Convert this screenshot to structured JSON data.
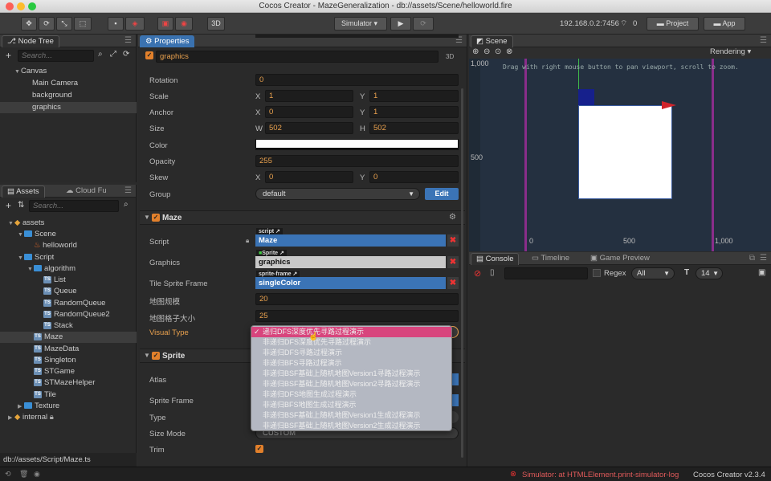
{
  "window": {
    "title": "Cocos Creator - MazeGeneralization - db://assets/Scene/helloworld.fire"
  },
  "toolbar": {
    "btn_3d": "3D",
    "ip": "192.168.0.2:7456",
    "conn_count": "0",
    "simulator": "Simulator",
    "project": "Project",
    "app": "App"
  },
  "node_tree": {
    "tab": "Node Tree",
    "search_placeholder": "Search...",
    "items": [
      "Canvas",
      "Main Camera",
      "background",
      "graphics"
    ]
  },
  "assets": {
    "tab": "Assets",
    "tab2": "Cloud Fu",
    "search_placeholder": "Search...",
    "items": [
      "assets",
      "Scene",
      "helloworld",
      "Script",
      "algorithm",
      "List",
      "Queue",
      "RandomQueue",
      "RandomQueue2",
      "Stack",
      "Maze",
      "MazeData",
      "Singleton",
      "STGame",
      "STMazeHelper",
      "Tile",
      "Texture",
      "internal"
    ],
    "path": "db://assets/Script/Maze.ts"
  },
  "properties": {
    "tab": "Properties",
    "node_name": "graphics",
    "btn_3d": "3D",
    "rows": {
      "rotation_label": "Rotation",
      "rotation": "0",
      "scale_label": "Scale",
      "scale_x": "1",
      "scale_y": "1",
      "anchor_label": "Anchor",
      "anchor_x": "0",
      "anchor_y": "1",
      "size_label": "Size",
      "size_w": "502",
      "size_h": "502",
      "color_label": "Color",
      "opacity_label": "Opacity",
      "opacity": "255",
      "skew_label": "Skew",
      "skew_x": "0",
      "skew_y": "0",
      "group_label": "Group",
      "group": "default",
      "edit": "Edit"
    },
    "axis": {
      "x": "X",
      "y": "Y",
      "w": "W",
      "h": "H"
    },
    "maze": {
      "title": "Maze",
      "script_label": "Script",
      "script_tag": "script",
      "script": "Maze",
      "graphics_label": "Graphics",
      "graphics_tag": "Sprite",
      "graphics": "graphics",
      "tsf_label": "Tile Sprite Frame",
      "tsf_tag": "sprite-frame",
      "tsf": "singleColor",
      "scale_label": "地图规模",
      "scale": "20",
      "cell_label": "地图格子大小",
      "cell": "25",
      "vt_label": "Visual Type"
    },
    "sprite": {
      "title": "Sprite",
      "atlas": "Atlas",
      "sprite_frame": "Sprite Frame",
      "type": "Type",
      "size_mode": "Size Mode",
      "size_mode_val": "CUSTOM",
      "trim": "Trim"
    },
    "dropdown": [
      "递归DFS深度优先寻路过程演示",
      "非递归DFS深度优先寻路过程演示",
      "非递归DFS寻路过程演示",
      "非递归BFS寻路过程演示",
      "非递归BSF基础上随机地图Version1寻路过程演示",
      "非递归BSF基础上随机地图Version2寻路过程演示",
      "非递归DFS地图生成过程演示",
      "非递归BFS地图生成过程演示",
      "非递归BSF基础上随机地图Version1生成过程演示",
      "非递归BSF基础上随机地图Version2生成过程演示"
    ]
  },
  "scene": {
    "tab": "Scene",
    "rendering": "Rendering",
    "hint": "Drag with right mouse button to pan viewport, scroll to zoom.",
    "y_top": "1,000",
    "y_mid": "500",
    "x0": "0",
    "x500": "500",
    "x1000": "1,000"
  },
  "console": {
    "tab": "Console",
    "timeline": "Timeline",
    "game_preview": "Game Preview",
    "regex": "Regex",
    "filter": "All",
    "font_size": "14"
  },
  "status": {
    "error": "Simulator: at HTMLElement.print-simulator-log",
    "version": "Cocos Creator v2.3.4"
  },
  "colors": {
    "accent": "#e2802b",
    "select_blue": "#3b74b6",
    "dropdown_pink": "#d8457d",
    "maze_purple": "#8a2d8a"
  }
}
